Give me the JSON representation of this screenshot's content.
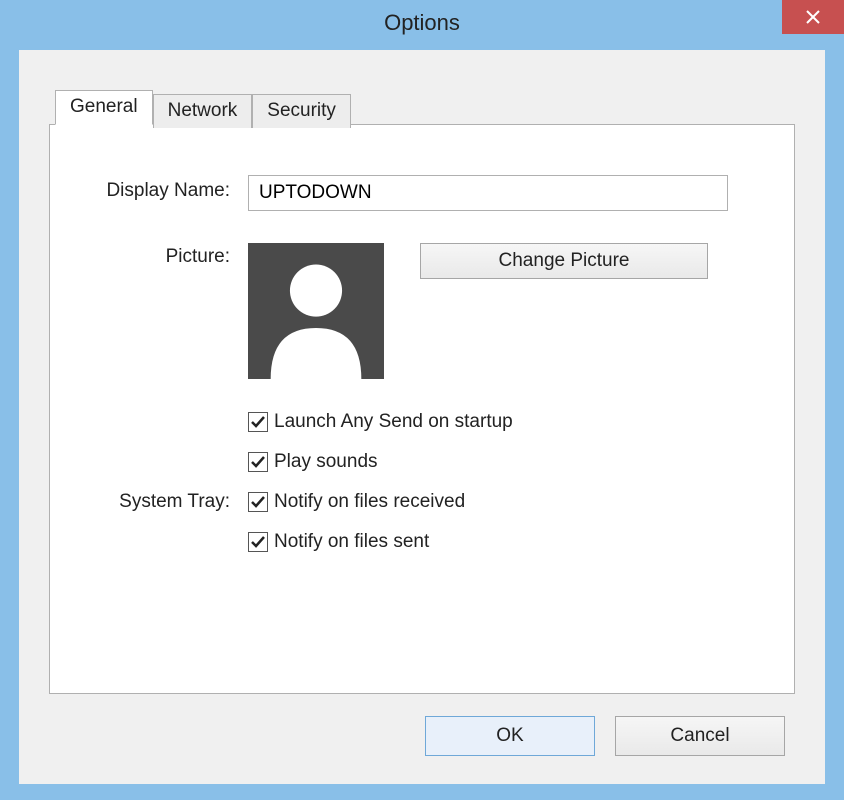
{
  "window": {
    "title": "Options"
  },
  "tabs": {
    "general": "General",
    "network": "Network",
    "security": "Security"
  },
  "form": {
    "displayNameLabel": "Display Name:",
    "displayNameValue": "UPTODOWN",
    "pictureLabel": "Picture:",
    "changePictureButton": "Change Picture",
    "launchOnStartup": "Launch Any Send on startup",
    "playSounds": "Play sounds",
    "systemTrayLabel": "System Tray:",
    "notifyReceived": "Notify on files received",
    "notifySent": "Notify on files sent"
  },
  "checked": {
    "launchOnStartup": true,
    "playSounds": true,
    "notifyReceived": true,
    "notifySent": true
  },
  "buttons": {
    "ok": "OK",
    "cancel": "Cancel"
  }
}
